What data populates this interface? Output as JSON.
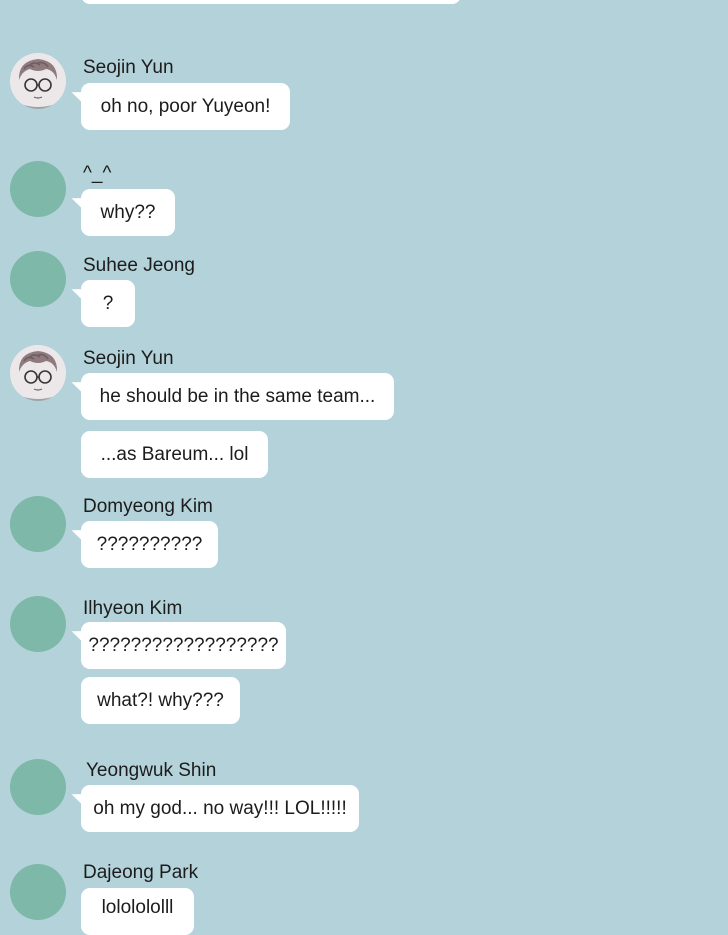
{
  "chat": {
    "messages": [
      {
        "sender": "Seojin Yun",
        "avatar": "portrait-avatar",
        "bubbles": [
          "oh no, poor Yuyeon!"
        ]
      },
      {
        "sender": "^_^",
        "avatar": "default-avatar",
        "bubbles": [
          "why??"
        ]
      },
      {
        "sender": "Suhee Jeong",
        "avatar": "default-avatar",
        "bubbles": [
          "?"
        ]
      },
      {
        "sender": "Seojin Yun",
        "avatar": "portrait-avatar",
        "bubbles": [
          "he should be in the same team...",
          "...as Bareum... lol"
        ]
      },
      {
        "sender": "Domyeong Kim",
        "avatar": "default-avatar",
        "bubbles": [
          "??????????"
        ]
      },
      {
        "sender": "Ilhyeon Kim",
        "avatar": "default-avatar",
        "bubbles": [
          "??????????????????",
          "what?! why???"
        ]
      },
      {
        "sender": "Yeongwuk Shin",
        "avatar": "default-avatar",
        "bubbles": [
          "oh my god... no way!!! LOL!!!!!"
        ]
      },
      {
        "sender": "Dajeong Park",
        "avatar": "default-avatar",
        "bubbles": [
          "lololololll"
        ]
      }
    ]
  },
  "colors": {
    "background": "#b4d2da",
    "bubble": "#ffffff",
    "default_avatar": "#7db8a8"
  }
}
